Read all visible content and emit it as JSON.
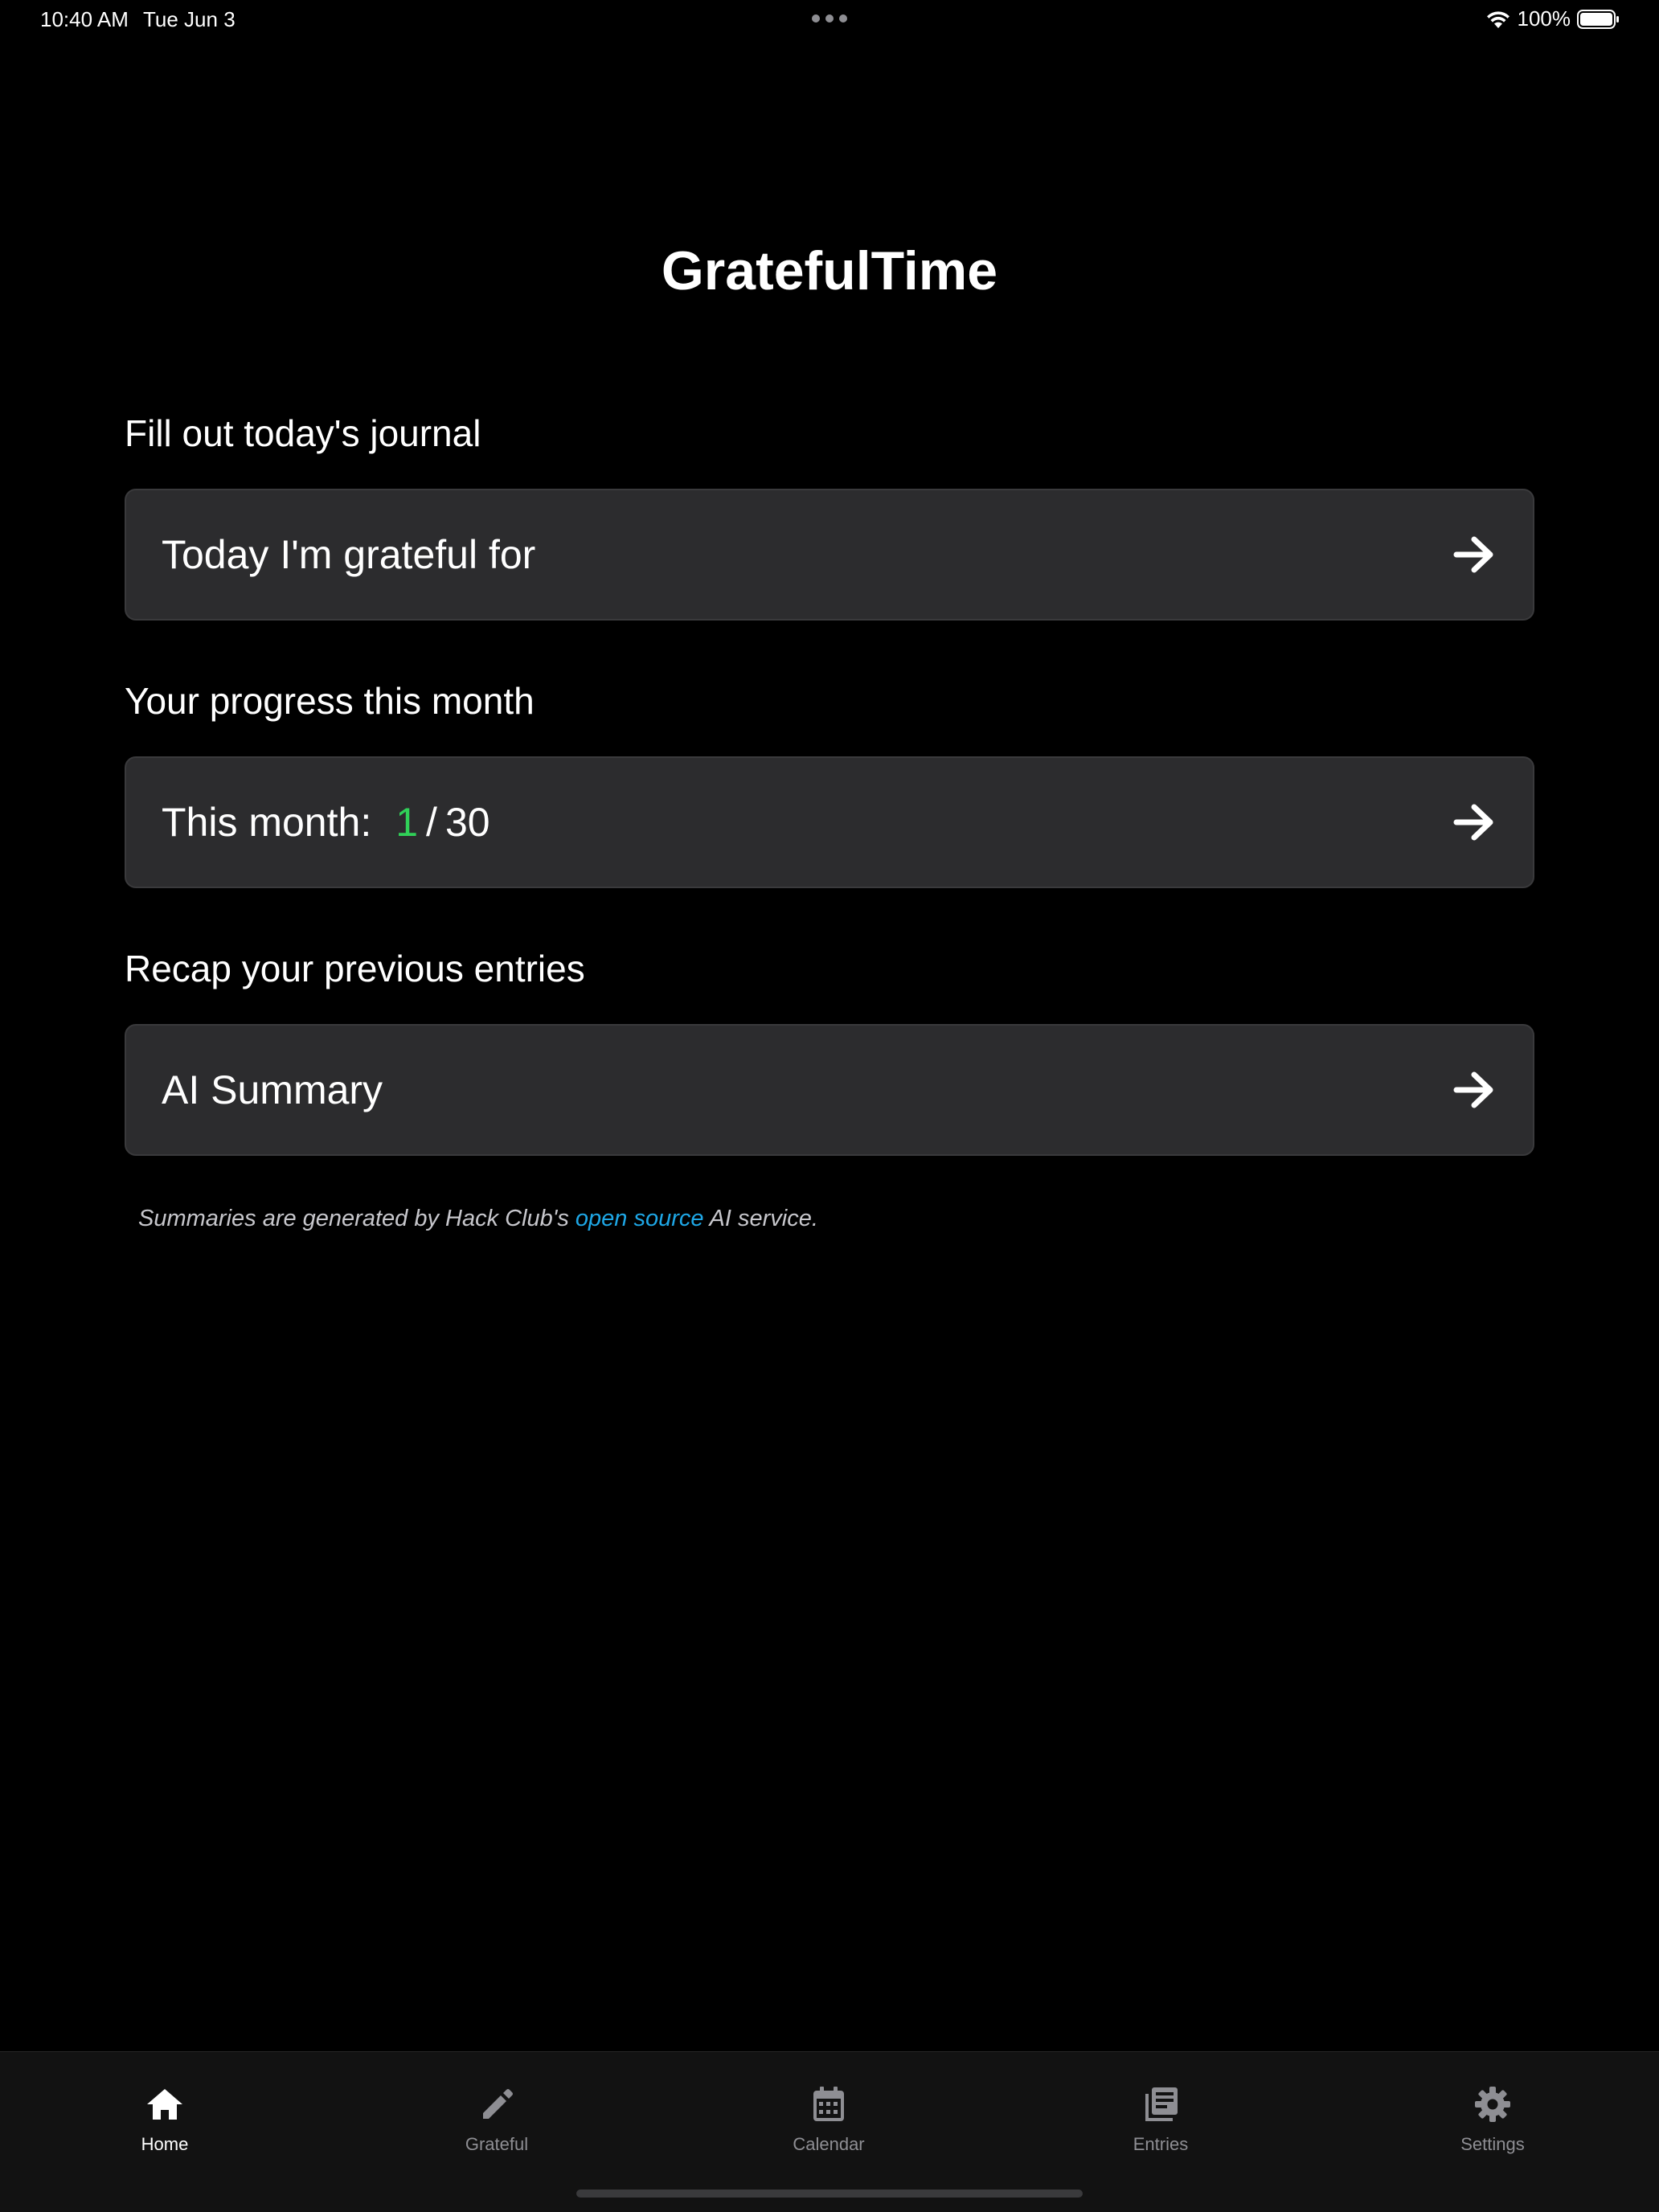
{
  "status_bar": {
    "time": "10:40 AM",
    "date": "Tue Jun 3",
    "battery": "100%"
  },
  "app": {
    "title": "GratefulTime"
  },
  "sections": {
    "journal": {
      "heading": "Fill out today's journal",
      "card_label": "Today I'm grateful for"
    },
    "progress": {
      "heading": "Your progress this month",
      "card_label": "This month:",
      "current": "1",
      "separator": "/",
      "total": "30"
    },
    "recap": {
      "heading": "Recap your previous entries",
      "card_label": "AI Summary"
    }
  },
  "footnote": {
    "prefix": "Summaries are generated by Hack Club's ",
    "link": "open source",
    "suffix": " AI service."
  },
  "tab_bar": {
    "tabs": [
      {
        "label": "Home",
        "icon": "home-icon",
        "active": true
      },
      {
        "label": "Grateful",
        "icon": "pencil-icon",
        "active": false
      },
      {
        "label": "Calendar",
        "icon": "calendar-icon",
        "active": false
      },
      {
        "label": "Entries",
        "icon": "entries-icon",
        "active": false
      },
      {
        "label": "Settings",
        "icon": "gear-icon",
        "active": false
      }
    ]
  },
  "colors": {
    "background": "#000000",
    "card": "#2c2c2e",
    "progress_accent": "#30d158",
    "link": "#1ea7e6",
    "tab_inactive": "#8e8e93"
  }
}
